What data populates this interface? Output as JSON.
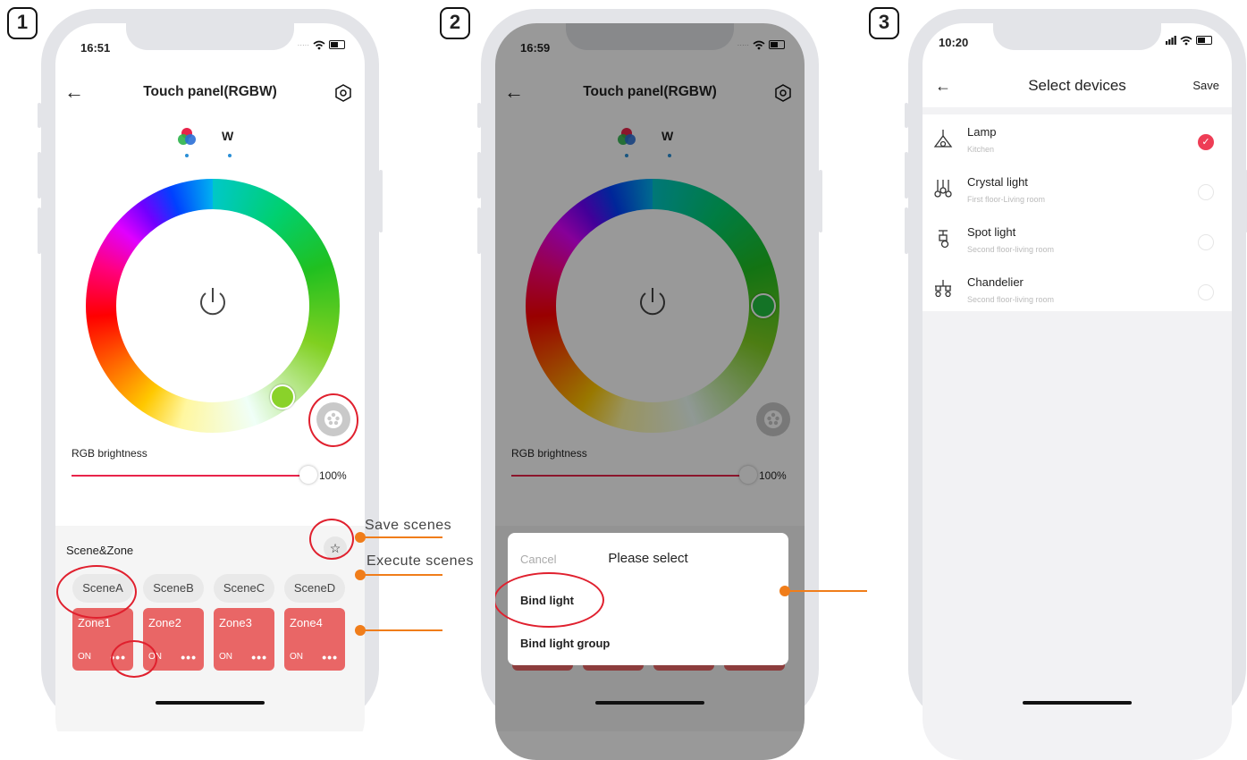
{
  "steps": [
    "1",
    "2",
    "3"
  ],
  "phone1": {
    "time": "16:51",
    "title": "Touch panel(RGBW)",
    "tab_w": "W",
    "brightness_label": "RGB brightness",
    "brightness_value": "100%",
    "brightness_level": 1.0,
    "scene_zone_label": "Scene&Zone",
    "scenes": [
      "SceneA",
      "SceneB",
      "SceneC",
      "SceneD"
    ],
    "zones": [
      {
        "name": "Zone1",
        "state": "ON",
        "more": "•••"
      },
      {
        "name": "Zone2",
        "state": "ON",
        "more": "•••"
      },
      {
        "name": "Zone3",
        "state": "ON",
        "more": "•••"
      },
      {
        "name": "Zone4",
        "state": "ON",
        "more": "•••"
      }
    ]
  },
  "annotations": {
    "save_scenes": "Save scenes",
    "execute_scenes": "Execute scenes"
  },
  "phone2": {
    "time": "16:59",
    "title": "Touch panel(RGBW)",
    "tab_w": "W",
    "brightness_label": "RGB brightness",
    "brightness_value": "100%",
    "sheet": {
      "cancel": "Cancel",
      "title": "Please select",
      "options": [
        "Bind light",
        "Bind light group"
      ]
    }
  },
  "phone3": {
    "time": "10:20",
    "title": "Select devices",
    "save": "Save",
    "devices": [
      {
        "name": "Lamp",
        "room": "Kitchen",
        "selected": true
      },
      {
        "name": "Crystal light",
        "room": "First floor-Living room",
        "selected": false
      },
      {
        "name": "Spot light",
        "room": "Second floor-living room",
        "selected": false
      },
      {
        "name": "Chandelier",
        "room": "Second floor-living room",
        "selected": false
      }
    ]
  },
  "colors": {
    "accent": "#e8234a",
    "zone": "#e96666",
    "highlight": "#e0202e",
    "annotation": "#f07d1a",
    "phone_frame": "#e3e4e8"
  }
}
